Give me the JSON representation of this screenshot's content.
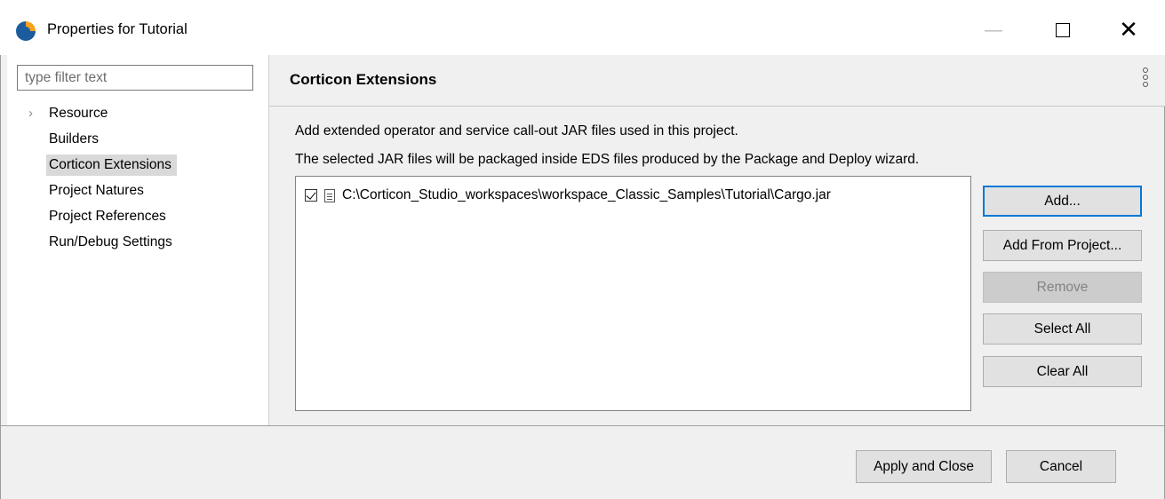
{
  "window": {
    "title": "Properties for Tutorial",
    "minimize_icon": "minimize-icon",
    "maximize_icon": "maximize-icon",
    "close_icon": "close-icon"
  },
  "filter": {
    "placeholder": "type filter text"
  },
  "tree": [
    {
      "label": "Resource",
      "expandable": true
    },
    {
      "label": "Builders"
    },
    {
      "label": "Corticon Extensions",
      "selected": true
    },
    {
      "label": "Project Natures"
    },
    {
      "label": "Project References"
    },
    {
      "label": "Run/Debug Settings"
    }
  ],
  "page": {
    "title": "Corticon Extensions",
    "menu_icon": "more-vertical-icon",
    "description_line1": "Add extended operator and service call-out JAR files used in this project.",
    "description_line2": "The selected JAR files will be packaged inside EDS files produced by the Package and Deploy wizard.",
    "jars": [
      {
        "path": "C:\\Corticon_Studio_workspaces\\workspace_Classic_Samples\\Tutorial\\Cargo.jar",
        "checked": true,
        "icon": "file-icon"
      }
    ],
    "buttons": {
      "add": "Add...",
      "add_from_project": "Add From Project...",
      "remove": "Remove",
      "select_all": "Select All",
      "clear_all": "Clear All"
    }
  },
  "footer": {
    "apply_close": "Apply and Close",
    "cancel": "Cancel"
  },
  "colors": {
    "accent_default_button": "#0078d7",
    "selection_bg": "#d9d9d9",
    "dialog_bg": "#f0f0f0"
  }
}
